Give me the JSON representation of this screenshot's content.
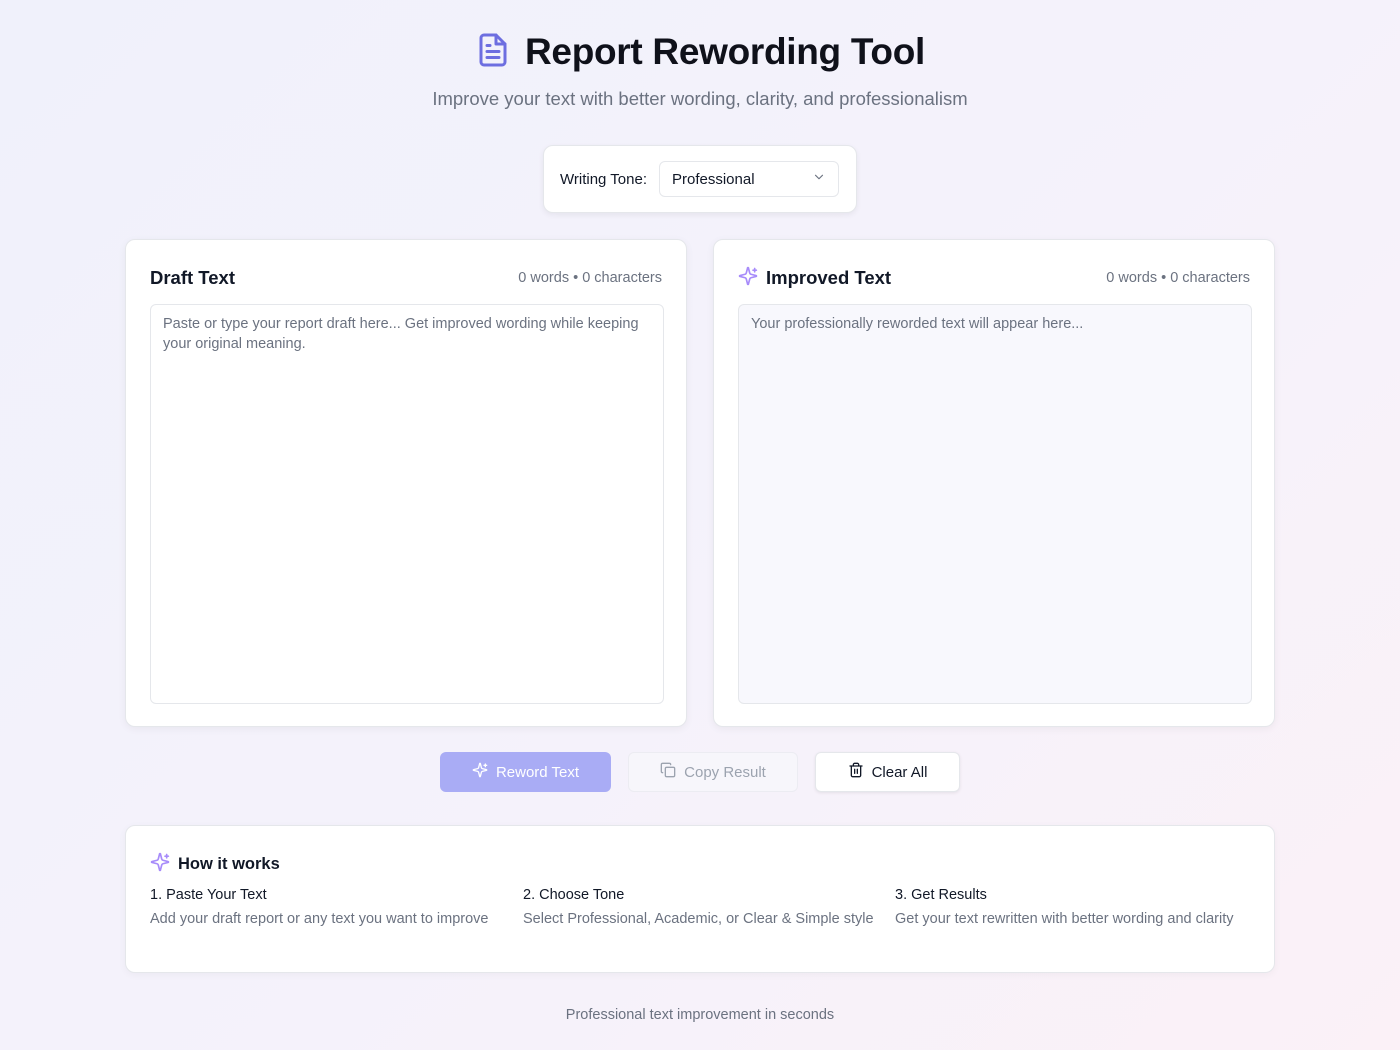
{
  "header": {
    "title": "Report Rewording Tool",
    "subtitle": "Improve your text with better wording, clarity, and professionalism",
    "icon": "document-icon"
  },
  "tone": {
    "label": "Writing Tone:",
    "selected": "Professional"
  },
  "draft": {
    "title": "Draft Text",
    "counts": "0 words • 0 characters",
    "value": "",
    "placeholder": "Paste or type your report draft here... Get improved wording while keeping your original meaning."
  },
  "improved": {
    "title": "Improved Text",
    "counts": "0 words • 0 characters",
    "placeholder": "Your professionally reworded text will appear here..."
  },
  "actions": {
    "reword_label": "Reword Text",
    "copy_label": "Copy Result",
    "clear_label": "Clear All"
  },
  "how": {
    "title": "How it works",
    "steps": [
      {
        "title": "1. Paste Your Text",
        "desc": "Add your draft report or any text you want to improve"
      },
      {
        "title": "2. Choose Tone",
        "desc": "Select Professional, Academic, or Clear & Simple style"
      },
      {
        "title": "3. Get Results",
        "desc": "Get your text rewritten with better wording and clarity"
      }
    ]
  },
  "footer": {
    "text": "Professional text improvement in seconds"
  },
  "colors": {
    "accent": "#6d6ee0",
    "accent_light": "#a9acf5",
    "sparkle": "#a78bfa"
  }
}
